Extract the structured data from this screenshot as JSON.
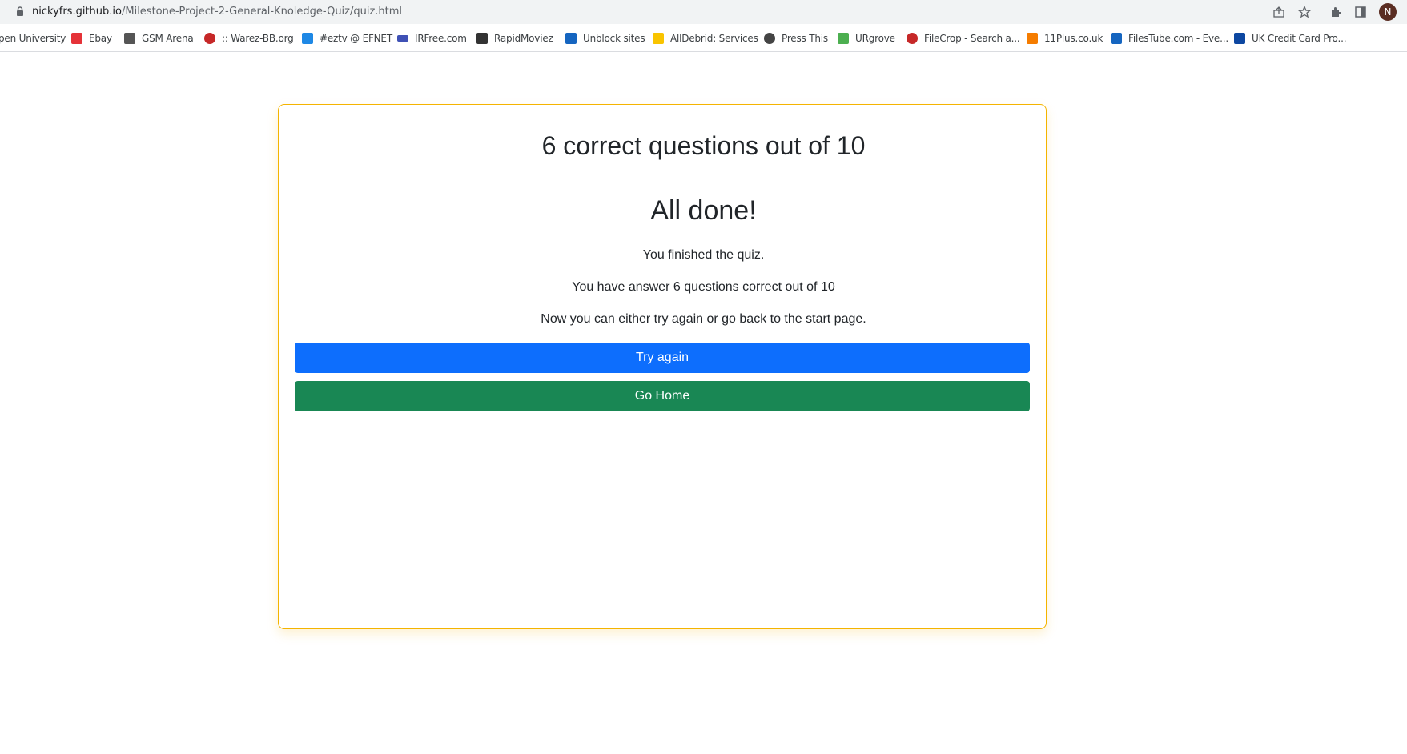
{
  "browser": {
    "url_host": "nickyfrs.github.io",
    "url_path": "/Milestone-Project-2-General-Knoledge-Quiz/quiz.html",
    "profile_initial": "N"
  },
  "bookmarks": [
    {
      "label": "pen University",
      "icon": "university-icon",
      "color": "#ffffff"
    },
    {
      "label": "Ebay",
      "icon": "ebay-bag-icon",
      "color": "#e53238"
    },
    {
      "label": "GSM Arena",
      "icon": "gsmarena-icon",
      "color": "#555555"
    },
    {
      "label": ":: Warez-BB.org",
      "icon": "warez-icon",
      "color": "#c62828"
    },
    {
      "label": "#eztv @ EFNET",
      "icon": "eztv-icon",
      "color": "#1e88e5"
    },
    {
      "label": "IRFree.com",
      "icon": "irfree-icon",
      "color": "#3f51b5"
    },
    {
      "label": "RapidMoviez",
      "icon": "rapidmoviez-icon",
      "color": "#333333"
    },
    {
      "label": "Unblock sites",
      "icon": "ft-icon",
      "color": "#1565c0"
    },
    {
      "label": "AllDebrid: Services",
      "icon": "alldebrid-icon",
      "color": "#f9c400"
    },
    {
      "label": "Press This",
      "icon": "wordpress-icon",
      "color": "#444444"
    },
    {
      "label": "URgrove",
      "icon": "urgrove-icon",
      "color": "#4caf50"
    },
    {
      "label": "FileCrop - Search a...",
      "icon": "filecrop-icon",
      "color": "#c62828"
    },
    {
      "label": "11Plus.co.uk",
      "icon": "elevenplus-icon",
      "color": "#f57c00"
    },
    {
      "label": "FilesTube.com - Eve...",
      "icon": "ft-icon",
      "color": "#1565c0"
    },
    {
      "label": "UK Credit Card Pro...",
      "icon": "v-icon",
      "color": "#0d47a1"
    }
  ],
  "quiz": {
    "score_title": "6 correct questions out of 10",
    "done_title": "All done!",
    "finished_msg": "You finished the quiz.",
    "answer_msg": "You have answer 6 questions correct out of 10",
    "options_msg": "Now you can either try again or go back to the start page.",
    "try_again_label": "Try again",
    "go_home_label": "Go Home"
  },
  "colors": {
    "primary": "#0d6efd",
    "success": "#198754",
    "card_border": "#f4b400"
  }
}
